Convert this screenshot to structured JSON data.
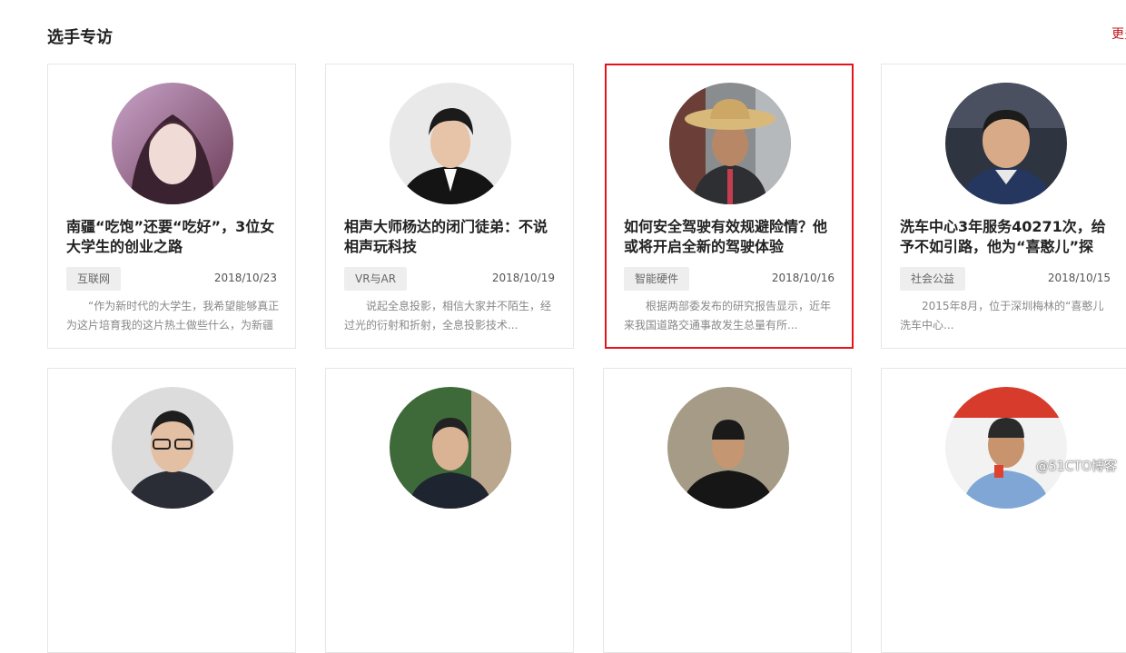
{
  "section": {
    "title": "选手专访",
    "more": "更多"
  },
  "cards": [
    {
      "title": "南疆“吃饱”还要“吃好”，3位女大学生的创业之路",
      "tag": "互联网",
      "date": "2018/10/23",
      "desc": "“作为新时代的大学生，我希望能够真正为这片培育我的这片热土做些什么，为新疆"
    },
    {
      "title": "相声大师杨达的闭门徒弟：不说相声玩科技",
      "tag": "VR与AR",
      "date": "2018/10/19",
      "desc": "说起全息投影，相信大家并不陌生，经过光的衍射和折射，全息投影技术..."
    },
    {
      "title": "如何安全驾驶有效规避险情？他或将开启全新的驾驶体验",
      "tag": "智能硬件",
      "date": "2018/10/16",
      "desc": "根据两部委发布的研究报告显示，近年来我国道路交通事故发生总量有所..."
    },
    {
      "title": "洗车中心3年服务40271次，给予不如引路，他为“喜憨儿”探",
      "tag": "社会公益",
      "date": "2018/10/15",
      "desc": "2015年8月，位于深圳梅林的“喜憨儿洗车中心..."
    }
  ],
  "watermark": "@51CTO博客"
}
